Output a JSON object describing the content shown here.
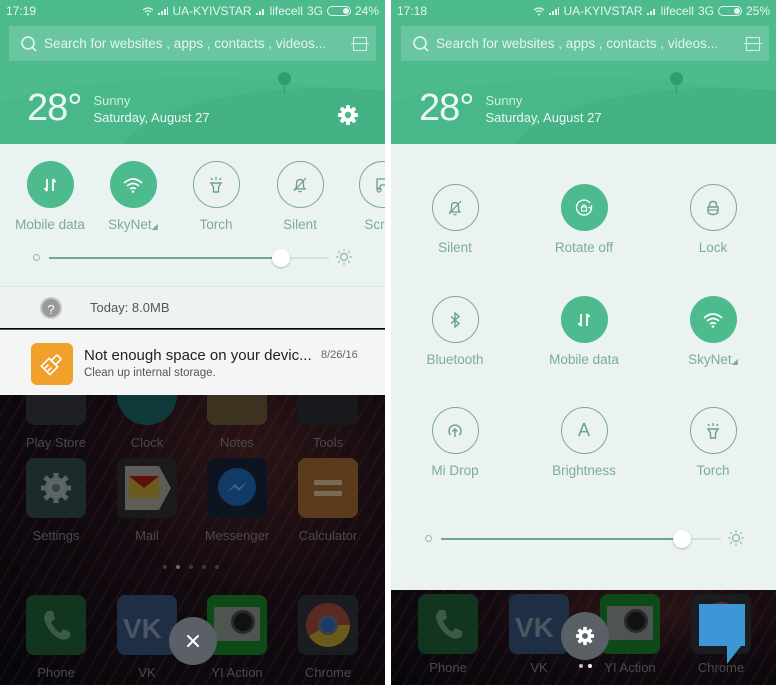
{
  "left": {
    "status": {
      "time": "17:19",
      "carrier1": "UA-KYIVSTAR",
      "carrier2": "lifecell",
      "network": "3G",
      "battery": "24%",
      "battery_level": 0.24
    },
    "search": {
      "placeholder": "Search for websites , apps , contacts , videos...",
      "icon": "search-icon",
      "scan_icon": "scan-icon"
    },
    "weather": {
      "temperature": "28°",
      "condition": "Sunny",
      "date": "Saturday, August 27"
    },
    "toggles": [
      {
        "label": "Mobile data",
        "icon": "mobile-data-icon",
        "state": "on"
      },
      {
        "label": "SkyNet",
        "icon": "wifi-icon",
        "state": "on"
      },
      {
        "label": "Torch",
        "icon": "torch-icon",
        "state": "off"
      },
      {
        "label": "Silent",
        "icon": "silent-icon",
        "state": "off"
      },
      {
        "label": "Scree",
        "icon": "screenshot-icon",
        "state": "off"
      }
    ],
    "brightness": 0.83,
    "data_usage": "Today: 8.0MB",
    "notification": {
      "title": "Not enough space on your devic...",
      "subtitle": "Clean up internal storage.",
      "time": "8/26/16",
      "icon": "cleaner-brush-icon",
      "accent": "#f0a12c"
    },
    "home_row1": [
      "Play Store",
      "Clock",
      "Notes",
      "Tools"
    ],
    "home_row2": [
      "Settings",
      "Mail",
      "Messenger",
      "Calculator"
    ],
    "dock": [
      "Phone",
      "VK",
      "YI Action",
      "Chrome"
    ],
    "fab_icon": "close-icon"
  },
  "right": {
    "status": {
      "time": "17:18",
      "carrier1": "UA-KYIVSTAR",
      "carrier2": "lifecell",
      "network": "3G",
      "battery": "25%",
      "battery_level": 0.25
    },
    "search": {
      "placeholder": "Search for websites , apps , contacts , videos..."
    },
    "weather": {
      "temperature": "28°",
      "condition": "Sunny",
      "date": "Saturday, August 27"
    },
    "toggles": [
      {
        "label": "Silent",
        "icon": "silent-icon",
        "state": "off"
      },
      {
        "label": "Rotate off",
        "icon": "rotate-lock-icon",
        "state": "on"
      },
      {
        "label": "Lock",
        "icon": "lock-icon",
        "state": "off"
      },
      {
        "label": "Bluetooth",
        "icon": "bluetooth-icon",
        "state": "off"
      },
      {
        "label": "Mobile data",
        "icon": "mobile-data-icon",
        "state": "on"
      },
      {
        "label": "SkyNet",
        "icon": "wifi-icon",
        "state": "on"
      },
      {
        "label": "Mi Drop",
        "icon": "mi-drop-icon",
        "state": "off"
      },
      {
        "label": "Brightness",
        "icon": "auto-brightness-icon",
        "state": "off"
      },
      {
        "label": "Torch",
        "icon": "torch-icon",
        "state": "off"
      }
    ],
    "brightness": 0.86,
    "dock": [
      "Phone",
      "VK",
      "YI Action",
      "Chrome"
    ],
    "fab_icon": "gear-icon"
  },
  "colors": {
    "accent_green": "#4dbb8e",
    "panel_bg": "#eaf3f1",
    "toggle_label": "#7cab9b"
  }
}
